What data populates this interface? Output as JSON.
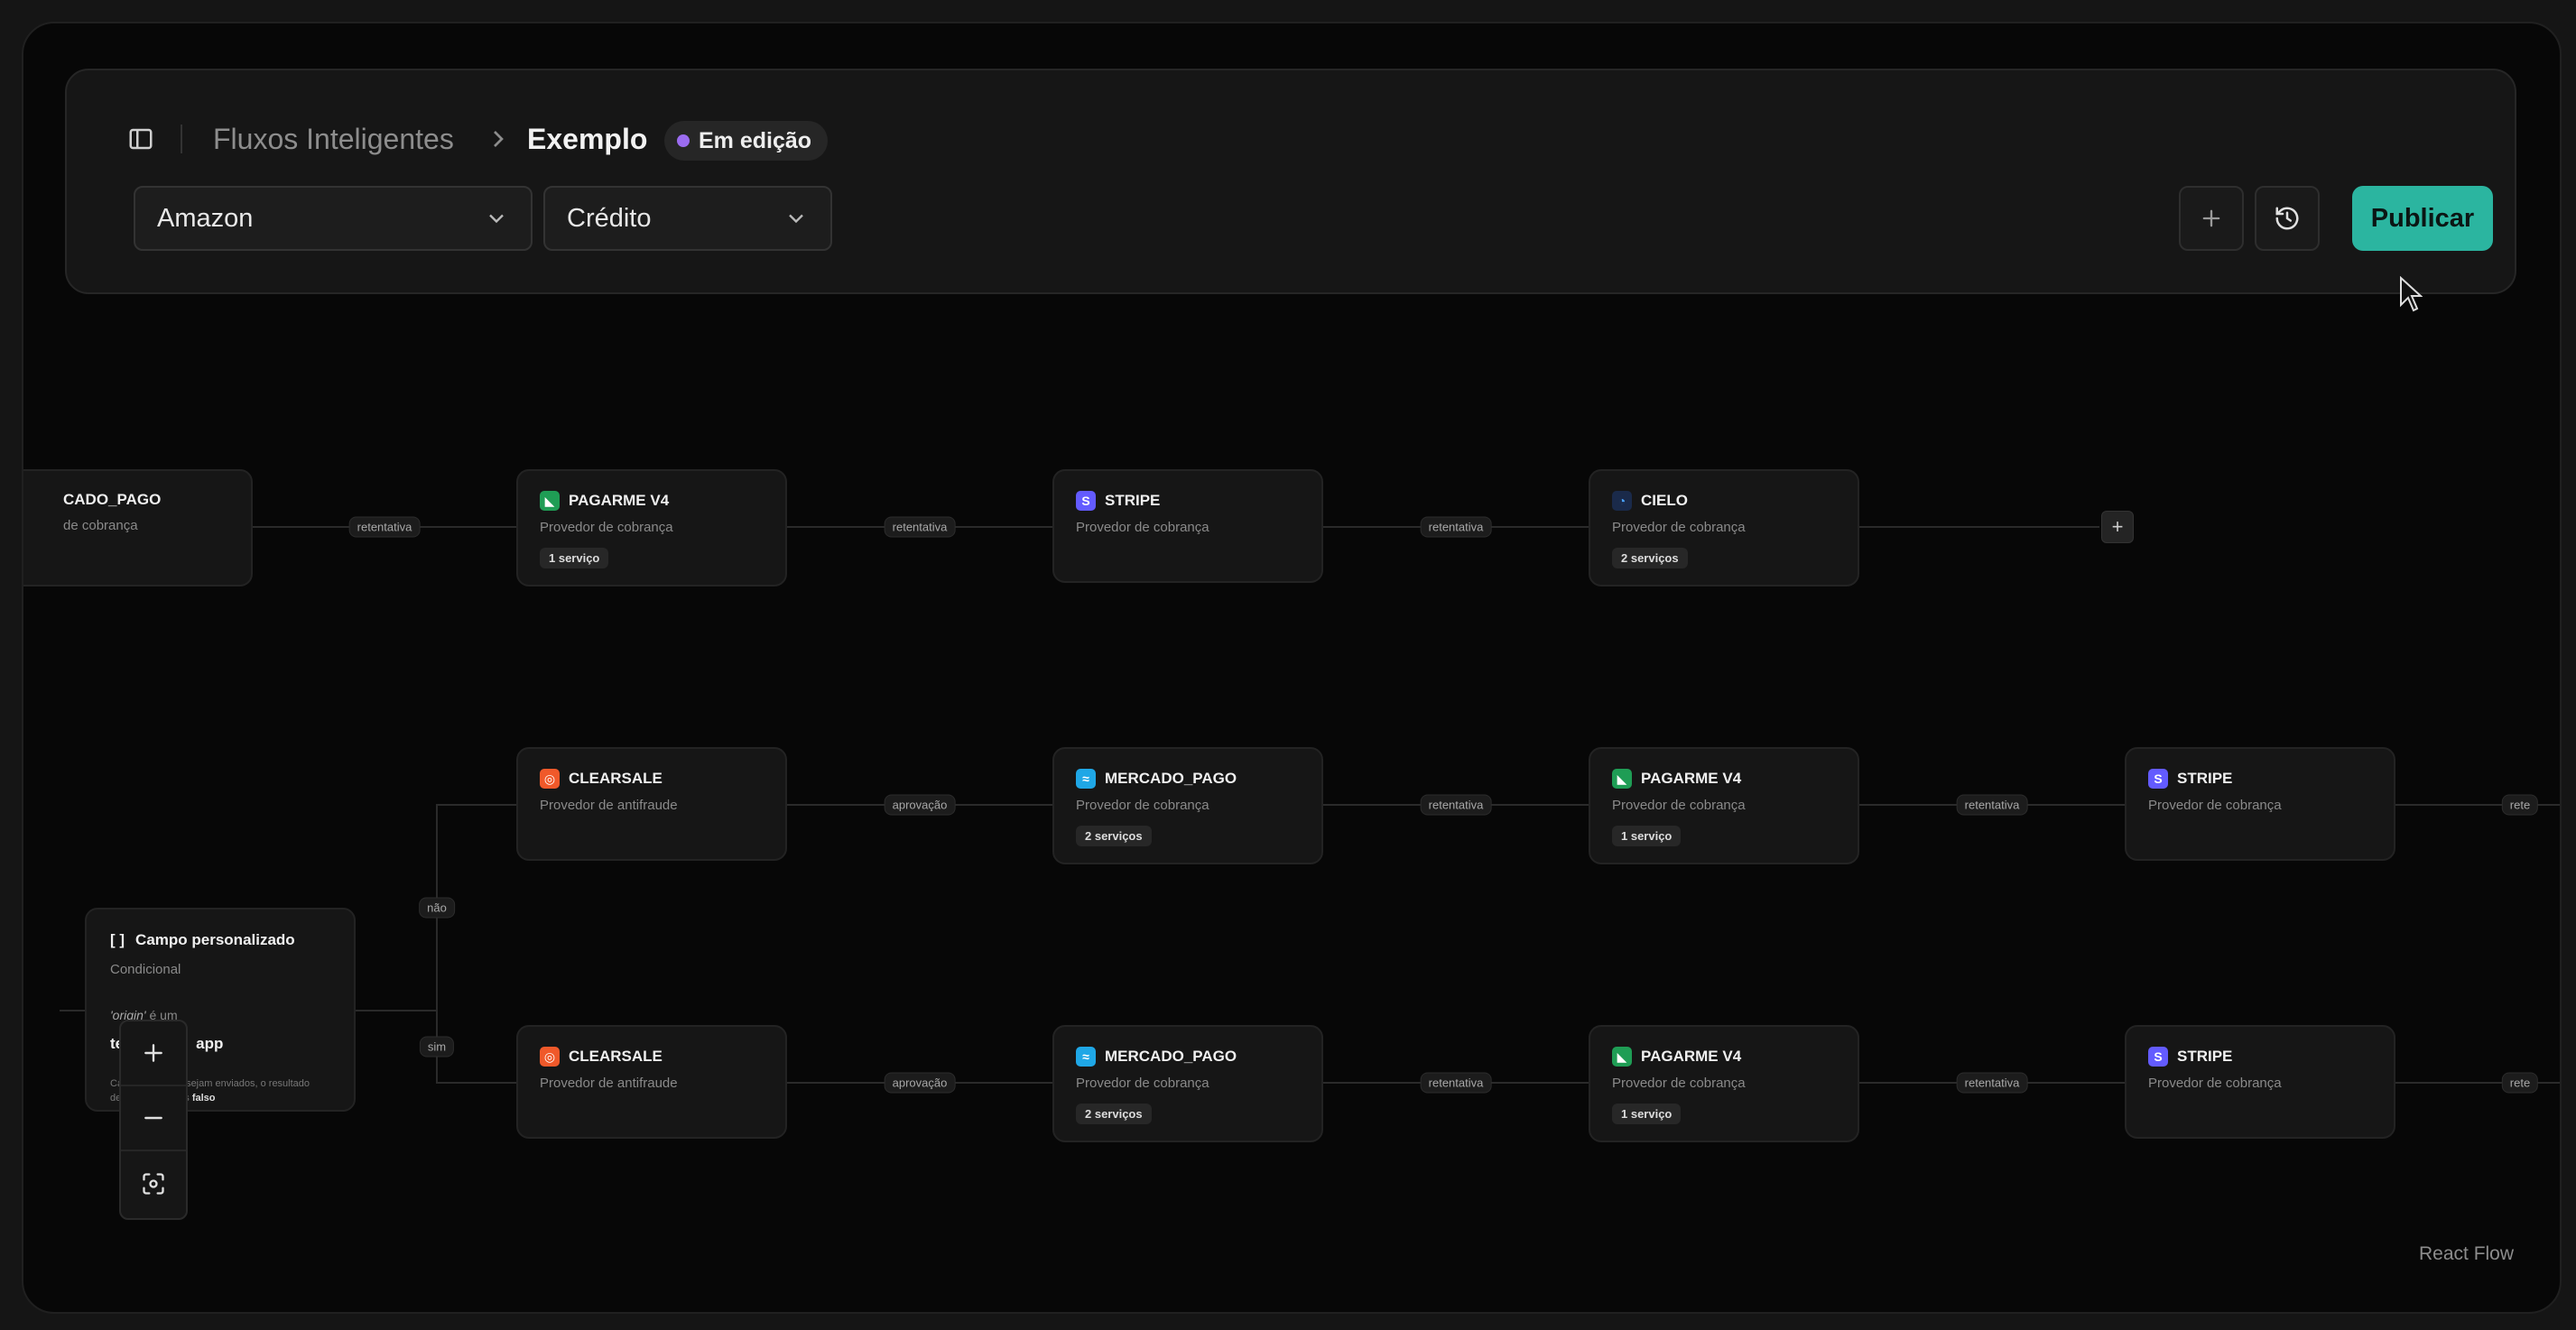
{
  "header": {
    "breadcrumb_root": "Fluxos Inteligentes",
    "breadcrumb_current": "Exemplo",
    "status_badge": "Em edição",
    "merchant_select": "Amazon",
    "method_select": "Crédito",
    "publish_label": "Publicar"
  },
  "flow": {
    "top_row": [
      {
        "title": "MERCADO_PAGO",
        "title_visible": "CADO_PAGO",
        "subtitle_visible": "de cobrança",
        "logo": "mercadopago-logo"
      },
      {
        "title": "PAGARME V4",
        "subtitle": "Provedor de cobrança",
        "badge": "1 serviço",
        "logo": "pagarme-logo"
      },
      {
        "title": "STRIPE",
        "subtitle": "Provedor de cobrança",
        "badge": "",
        "logo": "stripe-logo"
      },
      {
        "title": "CIELO",
        "subtitle": "Provedor de cobrança",
        "badge": "2 serviços",
        "logo": "cielo-logo"
      }
    ],
    "middle_row": [
      {
        "title": "CLEARSALE",
        "subtitle": "Provedor de antifraude",
        "badge": "",
        "logo": "clearsale-logo"
      },
      {
        "title": "MERCADO_PAGO",
        "subtitle": "Provedor de cobrança",
        "badge": "2 serviços",
        "logo": "mercadopago-logo"
      },
      {
        "title": "PAGARME V4",
        "subtitle": "Provedor de cobrança",
        "badge": "1 serviço",
        "logo": "pagarme-logo"
      },
      {
        "title": "STRIPE",
        "subtitle": "Provedor de cobrança",
        "badge": "",
        "logo": "stripe-logo"
      }
    ],
    "bottom_row": [
      {
        "title": "CLEARSALE",
        "subtitle": "Provedor de antifraude",
        "badge": "",
        "logo": "clearsale-logo"
      },
      {
        "title": "MERCADO_PAGO",
        "subtitle": "Provedor de cobrança",
        "badge": "2 serviços",
        "logo": "mercadopago-logo"
      },
      {
        "title": "PAGARME V4",
        "subtitle": "Provedor de cobrança",
        "badge": "1 serviço",
        "logo": "pagarme-logo"
      },
      {
        "title": "STRIPE",
        "subtitle": "Provedor de cobrança",
        "badge": "",
        "logo": "stripe-logo"
      }
    ],
    "edge_labels": {
      "retry": "retentativa",
      "retry_truncated": "rete",
      "approval": "aprovação",
      "no": "não",
      "yes": "sim"
    },
    "conditional_node": {
      "title_icon": "[ ]",
      "title": "Campo personalizado",
      "subtitle": "Condicional",
      "expr_field": "'origin'",
      "expr_op": " é um",
      "value_visible_a": "te",
      "value_visible_b": "app",
      "note_a": "Ca",
      "note_b": "sejam enviados, o resultado",
      "note_c": "de",
      "note_d": "s",
      "note_bold": "falso"
    }
  },
  "footer": {
    "attribution": "React Flow"
  },
  "colors": {
    "accent": "#2bb5a0",
    "edit_dot": "#9b6cf0",
    "pagarme": "#1f9d55",
    "stripe": "#635bff",
    "cielo": "#1f6fd1",
    "clearsale": "#f0592a",
    "mercadopago": "#1fa7e6"
  }
}
